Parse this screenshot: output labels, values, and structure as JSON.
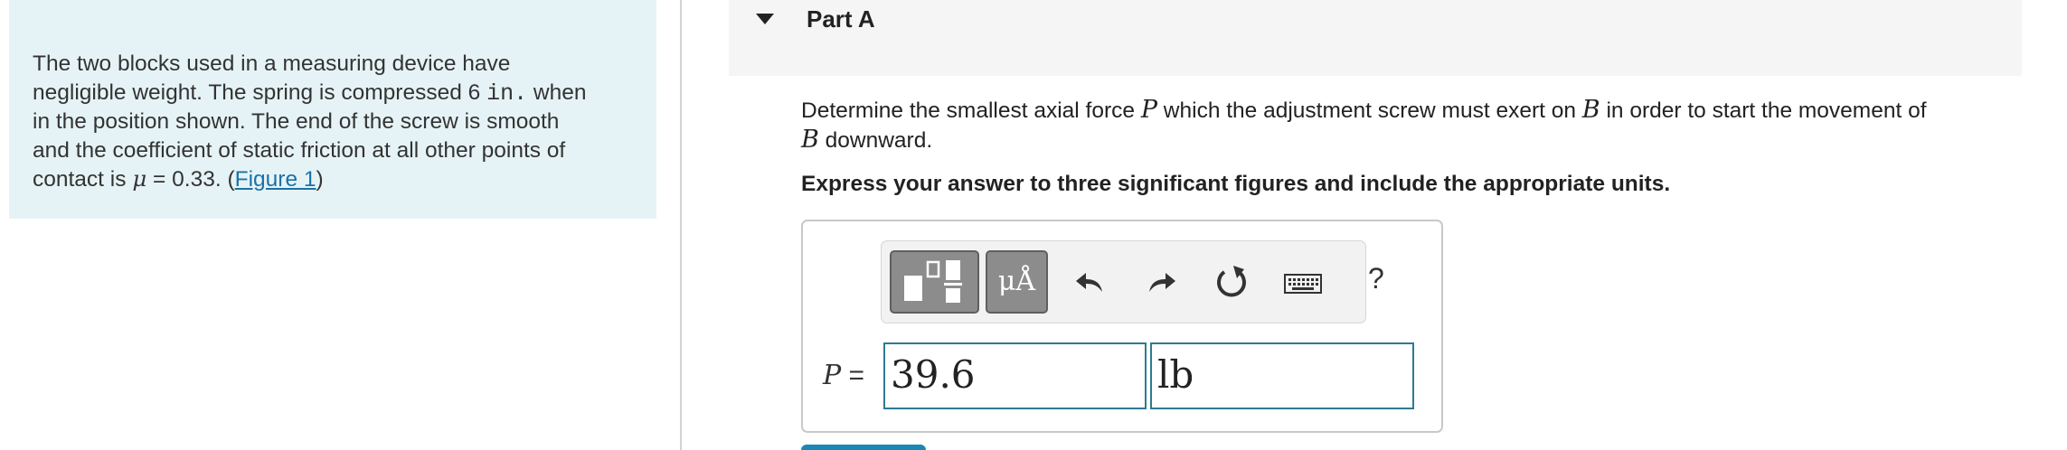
{
  "problem": {
    "line1": "The two blocks used in a measuring device have",
    "line2_before": "negligible weight. The spring is compressed 6 ",
    "line2_unit": "in.",
    "line2_after": " when",
    "line3": "in the position shown. The end of the screw is smooth",
    "line4": "and the coefficient of static friction at all other points of",
    "line5_before": "contact is ",
    "line5_mu": "μ",
    "line5_value": " = 0.33. (",
    "figure_link": "Figure 1",
    "line5_after": ")"
  },
  "part": {
    "title": "Part A",
    "toggle_icon": "caret-down-icon"
  },
  "question": {
    "t1": "Determine the smallest axial force ",
    "var_p": "P",
    "t2": " which the adjustment screw must exert on ",
    "var_b1": "B",
    "t3": " in order to start the movement of",
    "var_b2": "B",
    "t4": " downward."
  },
  "instruction": "Express your answer to three significant figures and include the appropriate units.",
  "toolbar": {
    "templates_icon": "templates-icon",
    "units_label": "μÅ",
    "undo_icon": "undo-icon",
    "redo_icon": "redo-icon",
    "reset_icon": "reset-icon",
    "keyboard_icon": "keyboard-icon",
    "help_label": "?"
  },
  "answer": {
    "variable": "P",
    "equals": " =",
    "value": "39.6",
    "units": "lb"
  },
  "colors": {
    "panel_bg": "#e6f3f6",
    "link": "#1a72a8",
    "input_border": "#2d7a93",
    "toolbar_button": "#8c8c8c"
  }
}
